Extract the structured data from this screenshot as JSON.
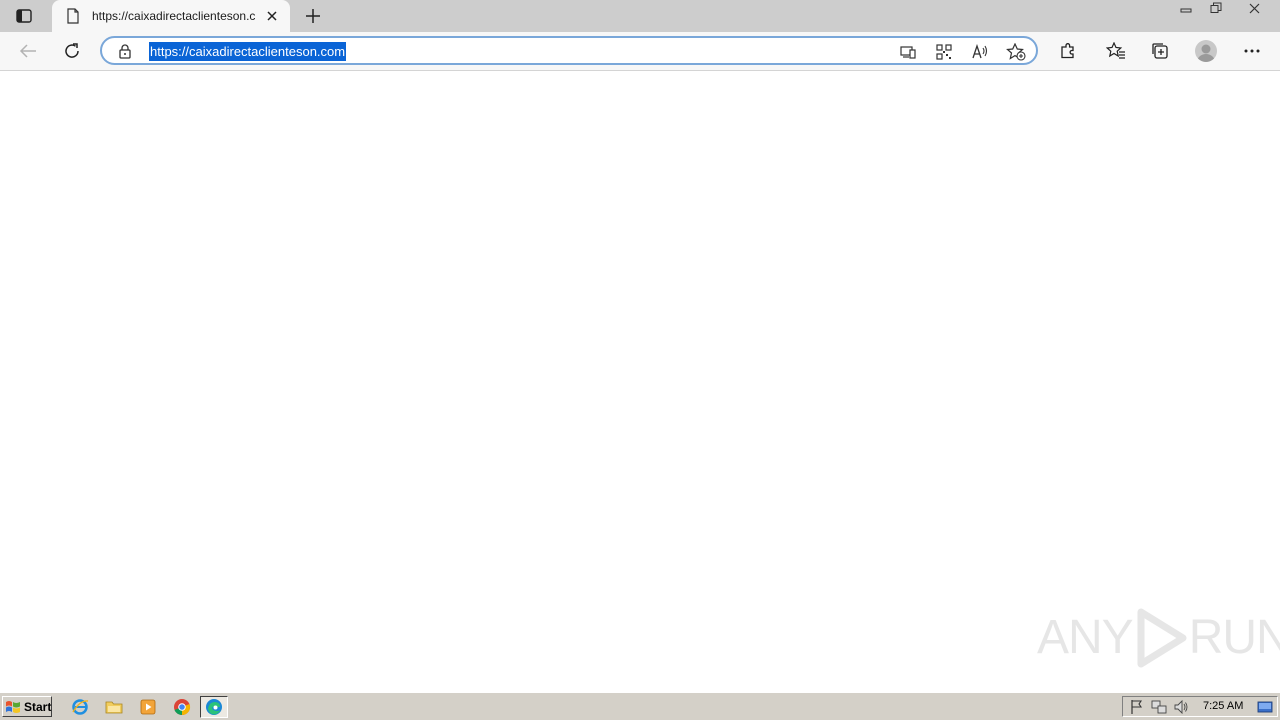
{
  "browser": {
    "tab": {
      "title": "https://caixadirectaclienteson.c"
    },
    "address_bar": {
      "url": "https://caixadirectaclienteson.com"
    }
  },
  "watermark": {
    "text_left": "ANY",
    "text_right": "RUN"
  },
  "taskbar": {
    "start_label": "Start",
    "clock": "7:25 AM"
  },
  "colors": {
    "titlebar": "#cdcdcd",
    "toolbar": "#f7f7f7",
    "url_selection": "#0a64d6",
    "taskbar": "#d4d0c8"
  }
}
